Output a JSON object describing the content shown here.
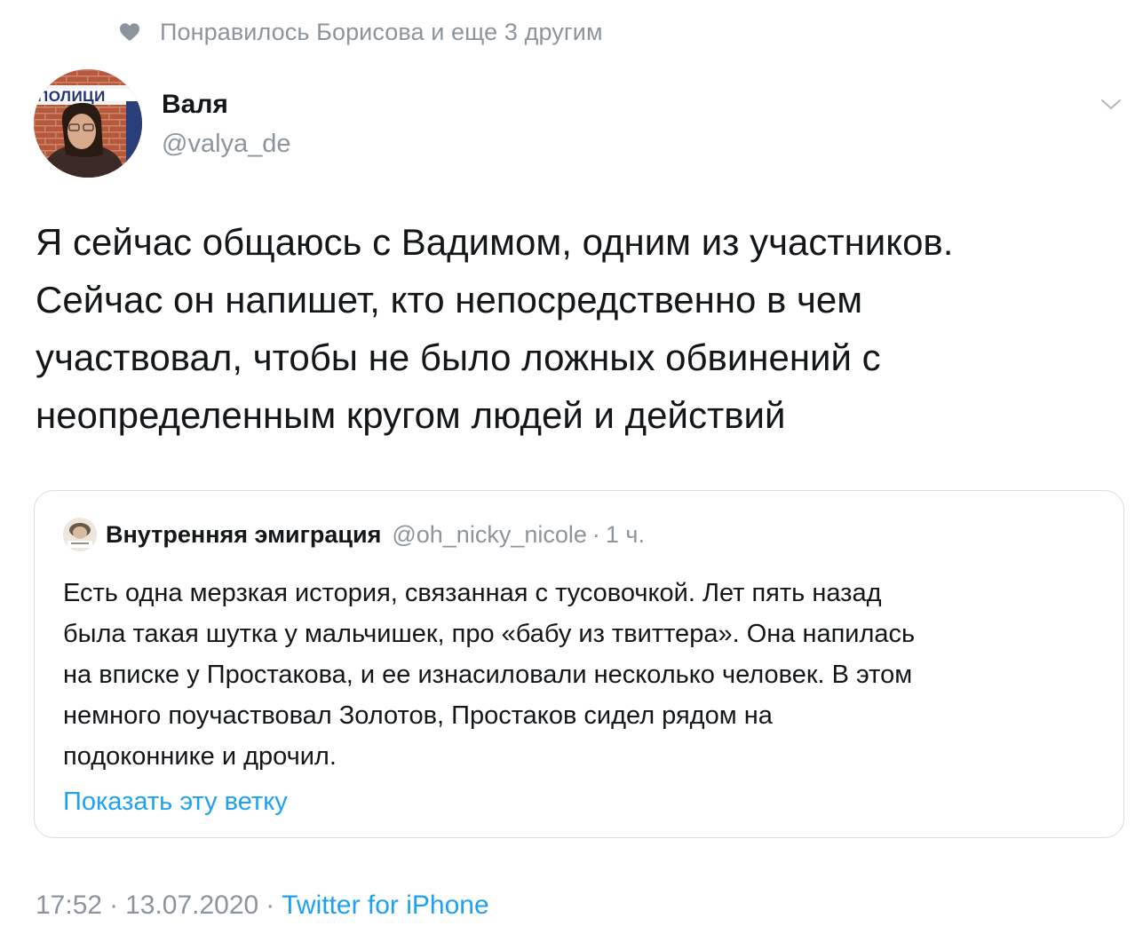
{
  "liked_by": {
    "icon": "heart-icon",
    "text": "Понравилось Борисова и еще 3 другим"
  },
  "author": {
    "avatar_badge": "ПОЛИЦИ",
    "name": "Валя",
    "handle": "@valya_de",
    "menu_icon": "chevron-down-icon"
  },
  "tweet": {
    "lines": [
      "Я сейчас общаюсь с Вадимом, одним из участников.",
      "Сейчас он напишет, кто непосредственно в чем",
      "участвовал, чтобы не было ложных обвинений с",
      "неопределенным кругом людей и действий"
    ]
  },
  "quoted": {
    "name": "Внутренняя эмиграция",
    "handle": "@oh_nicky_nicole",
    "separator": "·",
    "time": "1 ч.",
    "lines": [
      "Есть одна мерзкая история, связанная с тусовочкой. Лет пять назад",
      "была такая шутка у мальчишек, про «бабу из твиттера». Она напилась",
      "на вписке у Простакова, и ее изнасиловали несколько человек. В этом",
      "немного поучаствовал Золотов, Простаков сидел рядом на",
      "подоконнике и дрочил."
    ],
    "show_thread": "Показать эту ветку"
  },
  "meta": {
    "time": "17:52",
    "separator": "·",
    "date": "13.07.2020",
    "client": "Twitter for iPhone"
  },
  "colors": {
    "text": "#14171a",
    "secondary": "#8c959e",
    "link": "#1da1f2",
    "border": "#d8dde2"
  }
}
